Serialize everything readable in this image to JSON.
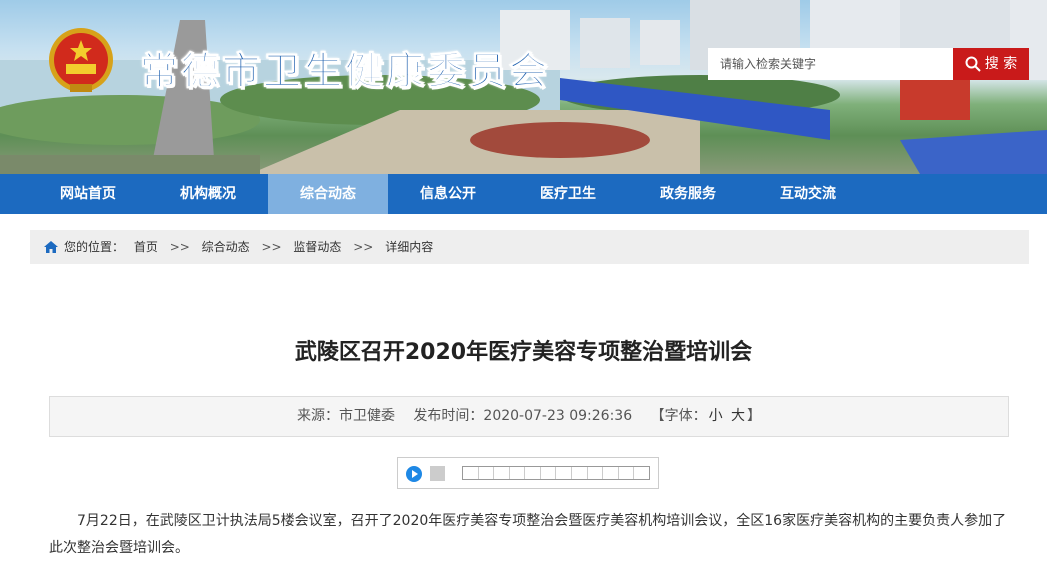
{
  "header": {
    "site_title": "常德市卫生健康委员会",
    "search_placeholder": "请输入检索关键字",
    "search_label": "搜 索"
  },
  "nav": {
    "items": [
      "网站首页",
      "机构概况",
      "综合动态",
      "信息公开",
      "医疗卫生",
      "政务服务",
      "互动交流"
    ],
    "active_index": 2
  },
  "breadcrumb": {
    "prefix": "您的位置：",
    "items": [
      "首页",
      "综合动态",
      "监督动态",
      "详细内容"
    ],
    "separator": ">>"
  },
  "article": {
    "title": "武陵区召开2020年医疗美容专项整治暨培训会",
    "source": "来源：市卫健委",
    "published": "发布时间：2020-07-23 09:26:36",
    "font_size_label": "【字体：",
    "font_small": "小",
    "font_big": "大",
    "font_size_end": "】",
    "paragraph": "7月22日，在武陵区卫计执法局5楼会议室，召开了2020年医疗美容专项整治会暨医疗美容机构培训会议，全区16家医疗美容机构的主要负责人参加了此次整治会暨培训会。"
  },
  "colors": {
    "nav_bg": "#1c6ac0",
    "nav_active": "#7fb0e0",
    "search_button": "#c91a1a",
    "title_blue": "#1d5fae"
  }
}
